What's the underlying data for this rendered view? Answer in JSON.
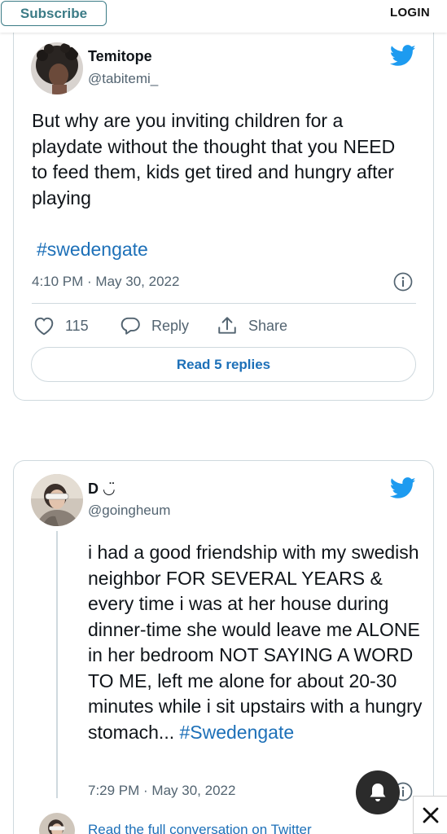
{
  "topbar": {
    "subscribe_label": "Subscribe",
    "login_label": "LOGIN"
  },
  "tweet1": {
    "display_name": "Temitope",
    "handle": "@tabitemi_",
    "text": "But why are you inviting children for a playdate without the thought that you NEED to feed them, kids get tired and hungry after playing",
    "hashtag": "#swedengate",
    "timestamp": "4:10 PM · May 30, 2022",
    "likes": "115",
    "reply_label": "Reply",
    "share_label": "Share",
    "read_replies_label": "Read 5 replies"
  },
  "tweet2": {
    "display_name": "D",
    "name_emoji": "◡̈",
    "handle": "@goingheum",
    "text": "i had a good friendship with my swedish neighbor FOR SEVERAL YEARS & every time i was at her house during dinner-time she would leave me ALONE in her bedroom NOT SAYING A WORD TO ME, left me alone for about 20-30 minutes while i sit upstairs with a hungry stomach... ",
    "hashtag": "#Swedengate",
    "timestamp": "7:29 PM · May 30, 2022",
    "footer_link": "Read the full conversation on Twitter"
  },
  "colors": {
    "twitter_blue": "#1d9bf0",
    "link_blue": "#1d70b8",
    "subscribe_teal": "#3b7b86",
    "border": "#cfd9de",
    "secondary_text": "#536471"
  },
  "icons": [
    "twitter-bird-icon",
    "heart-icon",
    "reply-bubble-icon",
    "share-icon",
    "info-icon",
    "bell-icon",
    "close-icon"
  ]
}
